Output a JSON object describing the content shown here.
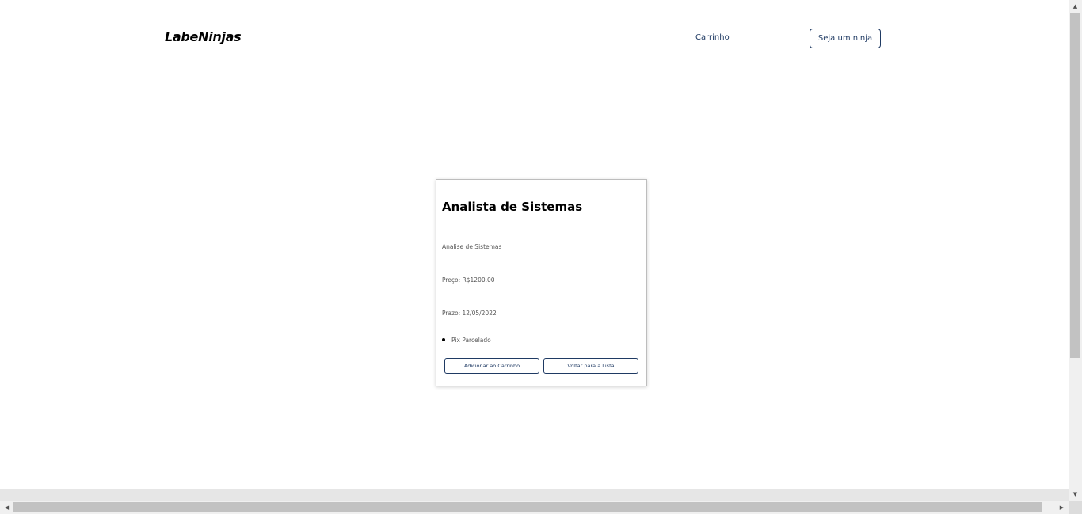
{
  "header": {
    "logo": "LabeNinjas",
    "cart_link": "Carrinho",
    "become_ninja_button": "Seja um ninja"
  },
  "service": {
    "title": "Analista de Sistemas",
    "description": "Analise de Sistemas",
    "price": "Preço: R$1200.00",
    "deadline": "Prazo: 12/05/2022",
    "payment_methods": [
      "Pix Parcelado"
    ],
    "add_to_cart_button": "Adicionar ao Carrinho",
    "back_to_list_button": "Voltar para a Lista"
  },
  "scrollbars": {
    "up_arrow": "▲",
    "down_arrow": "▼",
    "left_arrow": "◀",
    "right_arrow": "▶"
  },
  "colors": {
    "accent": "#1f3a63",
    "text_muted": "#555555",
    "card_border": "#bdbdbd"
  }
}
